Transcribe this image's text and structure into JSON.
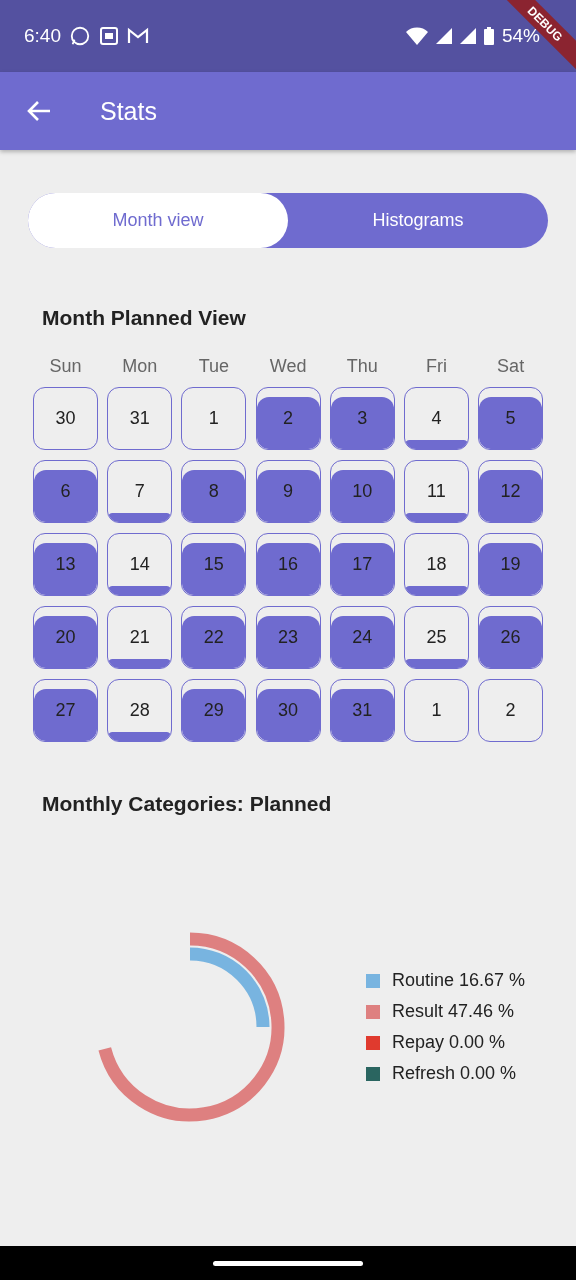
{
  "status_bar": {
    "time": "6:40",
    "battery": "54%"
  },
  "debug_banner": "DEBUG",
  "app_bar": {
    "title": "Stats"
  },
  "tabs": [
    {
      "label": "Month view",
      "selected": true
    },
    {
      "label": "Histograms",
      "selected": false
    }
  ],
  "calendar": {
    "title": "Month Planned View",
    "weekdays": [
      "Sun",
      "Mon",
      "Tue",
      "Wed",
      "Thu",
      "Fri",
      "Sat"
    ],
    "days": [
      {
        "label": "30",
        "kind": "empty"
      },
      {
        "label": "31",
        "kind": "empty"
      },
      {
        "label": "1",
        "kind": "empty"
      },
      {
        "label": "2",
        "kind": "full"
      },
      {
        "label": "3",
        "kind": "full"
      },
      {
        "label": "4",
        "kind": "partial"
      },
      {
        "label": "5",
        "kind": "full"
      },
      {
        "label": "6",
        "kind": "full"
      },
      {
        "label": "7",
        "kind": "partial"
      },
      {
        "label": "8",
        "kind": "full"
      },
      {
        "label": "9",
        "kind": "full"
      },
      {
        "label": "10",
        "kind": "full"
      },
      {
        "label": "11",
        "kind": "partial"
      },
      {
        "label": "12",
        "kind": "full"
      },
      {
        "label": "13",
        "kind": "full"
      },
      {
        "label": "14",
        "kind": "partial"
      },
      {
        "label": "15",
        "kind": "full"
      },
      {
        "label": "16",
        "kind": "full"
      },
      {
        "label": "17",
        "kind": "full"
      },
      {
        "label": "18",
        "kind": "partial"
      },
      {
        "label": "19",
        "kind": "full"
      },
      {
        "label": "20",
        "kind": "full"
      },
      {
        "label": "21",
        "kind": "partial"
      },
      {
        "label": "22",
        "kind": "full"
      },
      {
        "label": "23",
        "kind": "full"
      },
      {
        "label": "24",
        "kind": "full"
      },
      {
        "label": "25",
        "kind": "partial"
      },
      {
        "label": "26",
        "kind": "full"
      },
      {
        "label": "27",
        "kind": "full"
      },
      {
        "label": "28",
        "kind": "partial"
      },
      {
        "label": "29",
        "kind": "full"
      },
      {
        "label": "30",
        "kind": "full"
      },
      {
        "label": "31",
        "kind": "full"
      },
      {
        "label": "1",
        "kind": "empty"
      },
      {
        "label": "2",
        "kind": "empty"
      }
    ]
  },
  "categories": {
    "title": "Monthly Categories: Planned",
    "items": [
      {
        "label": "Routine 16.67 %",
        "color": "#78b4e0"
      },
      {
        "label": "Result 47.46 %",
        "color": "#de8080"
      },
      {
        "label": "Repay 0.00 %",
        "color": "#e03a2e"
      },
      {
        "label": "Refresh 0.00 %",
        "color": "#2a6560"
      }
    ]
  }
}
